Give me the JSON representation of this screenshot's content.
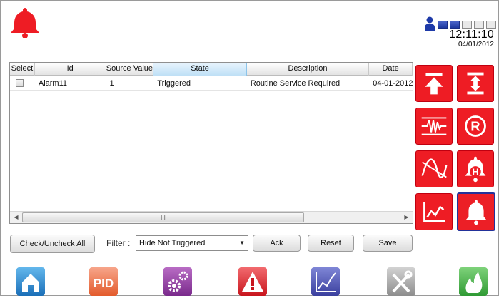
{
  "header": {
    "time": "12:11:10",
    "date": "04/01/2012",
    "signal_level_on": 2,
    "signal_level_total": 5
  },
  "table": {
    "columns": [
      "Select",
      "Id",
      "Source Value",
      "State",
      "Description",
      "Date"
    ],
    "sorted_column": "State",
    "rows": [
      {
        "selected": false,
        "id": "Alarm11",
        "source_value": "1",
        "state": "Triggered",
        "description": "Routine Service Required",
        "date": "04-01-2012"
      }
    ],
    "scroll_grip": "III"
  },
  "toolbar": {
    "check_all_label": "Check/Uncheck All",
    "filter_label": "Filter :",
    "filter_value": "Hide Not Triggered",
    "ack_label": "Ack",
    "reset_label": "Reset",
    "save_label": "Save"
  },
  "side_tiles": [
    {
      "icon": "arrow-up-to-bar-icon"
    },
    {
      "icon": "expand-vertical-icon"
    },
    {
      "icon": "waveform-limits-icon"
    },
    {
      "icon": "reset-r-icon"
    },
    {
      "icon": "curve-trend-icon"
    },
    {
      "icon": "alarm-history-h-icon"
    },
    {
      "icon": "trend-chart-icon"
    },
    {
      "icon": "alarm-bell-icon",
      "active": true
    }
  ],
  "bottom_nav": [
    {
      "icon": "home-icon",
      "text": ""
    },
    {
      "icon": "pid-icon",
      "text": "PID"
    },
    {
      "icon": "settings-gears-icon",
      "text": ""
    },
    {
      "icon": "alarm-warning-icon",
      "text": ""
    },
    {
      "icon": "trend-graph-icon",
      "text": ""
    },
    {
      "icon": "tools-icon",
      "text": ""
    },
    {
      "icon": "fire-icon",
      "text": ""
    }
  ],
  "colors": {
    "accent_red": "#ee1c24",
    "active_border": "#23329a",
    "sorted_header": "#bfe0f6"
  }
}
